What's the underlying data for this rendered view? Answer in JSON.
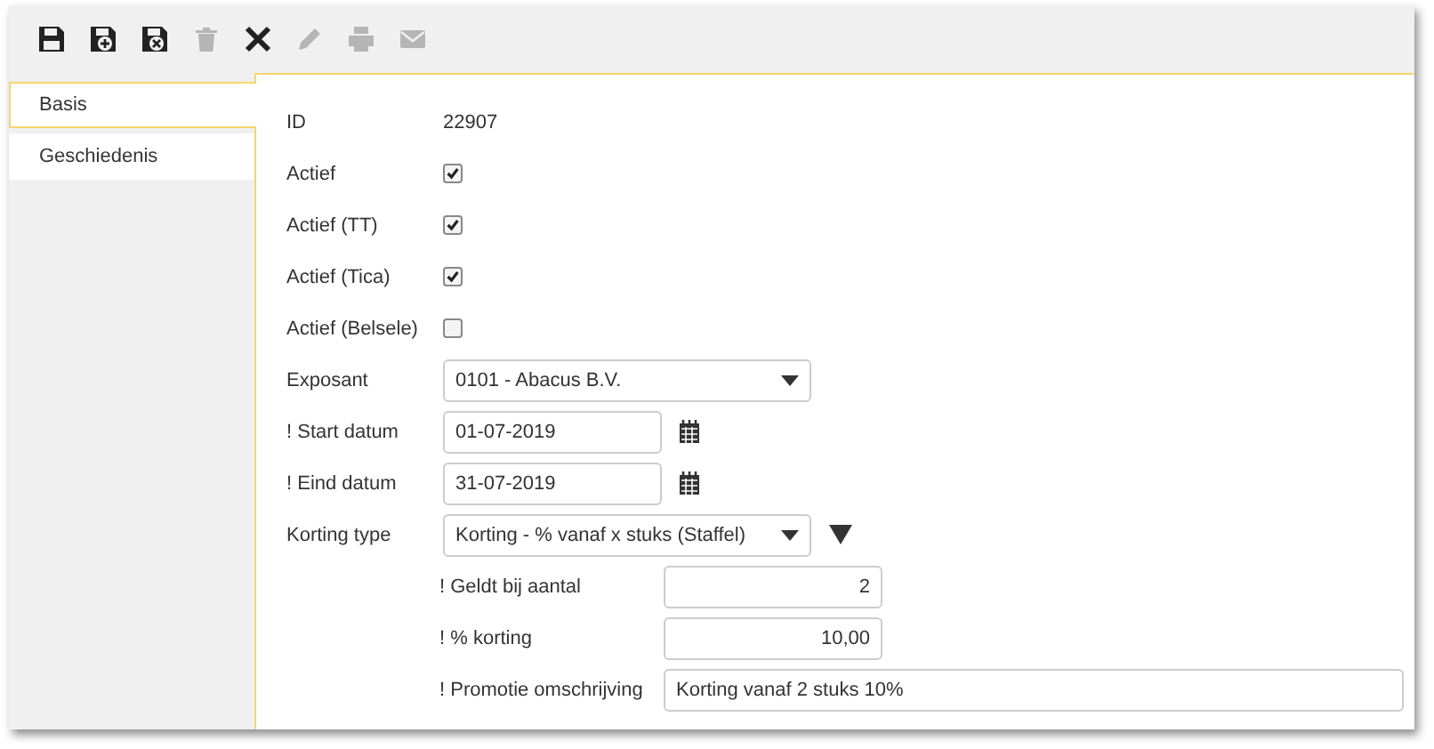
{
  "toolbar": [
    {
      "kind": "save",
      "disabled": false
    },
    {
      "kind": "save-add",
      "disabled": false
    },
    {
      "kind": "save-close",
      "disabled": false
    },
    {
      "kind": "delete",
      "disabled": true
    },
    {
      "kind": "close",
      "disabled": false
    },
    {
      "kind": "edit",
      "disabled": true
    },
    {
      "kind": "print",
      "disabled": true
    },
    {
      "kind": "mail",
      "disabled": true
    }
  ],
  "tabs": [
    {
      "label": "Basis",
      "selected": true
    },
    {
      "label": "Geschiedenis",
      "selected": false
    }
  ],
  "fields": [
    {
      "kind": "text",
      "label": "ID",
      "value": "22907"
    },
    {
      "kind": "checkbox",
      "label": "Actief",
      "checked": true
    },
    {
      "kind": "checkbox",
      "label": "Actief (TT)",
      "checked": true
    },
    {
      "kind": "checkbox",
      "label": "Actief (Tica)",
      "checked": true
    },
    {
      "kind": "checkbox",
      "label": "Actief (Belsele)",
      "checked": false
    },
    {
      "kind": "select",
      "label": "Exposant",
      "value": "0101 - Abacus B.V."
    },
    {
      "kind": "date",
      "label": "! Start datum",
      "value": "01-07-2019"
    },
    {
      "kind": "date",
      "label": "! Eind datum",
      "value": "31-07-2019"
    },
    {
      "kind": "select-filter",
      "label": "Korting type",
      "value": "Korting - % vanaf x stuks (Staffel)"
    }
  ],
  "subfields": [
    {
      "kind": "number",
      "label": "! Geldt bij aantal",
      "value": "2"
    },
    {
      "kind": "number",
      "label": "! % korting",
      "value": "10,00"
    },
    {
      "kind": "text",
      "label": "! Promotie omschrijving",
      "value": "Korting vanaf 2 stuks 10%"
    }
  ]
}
